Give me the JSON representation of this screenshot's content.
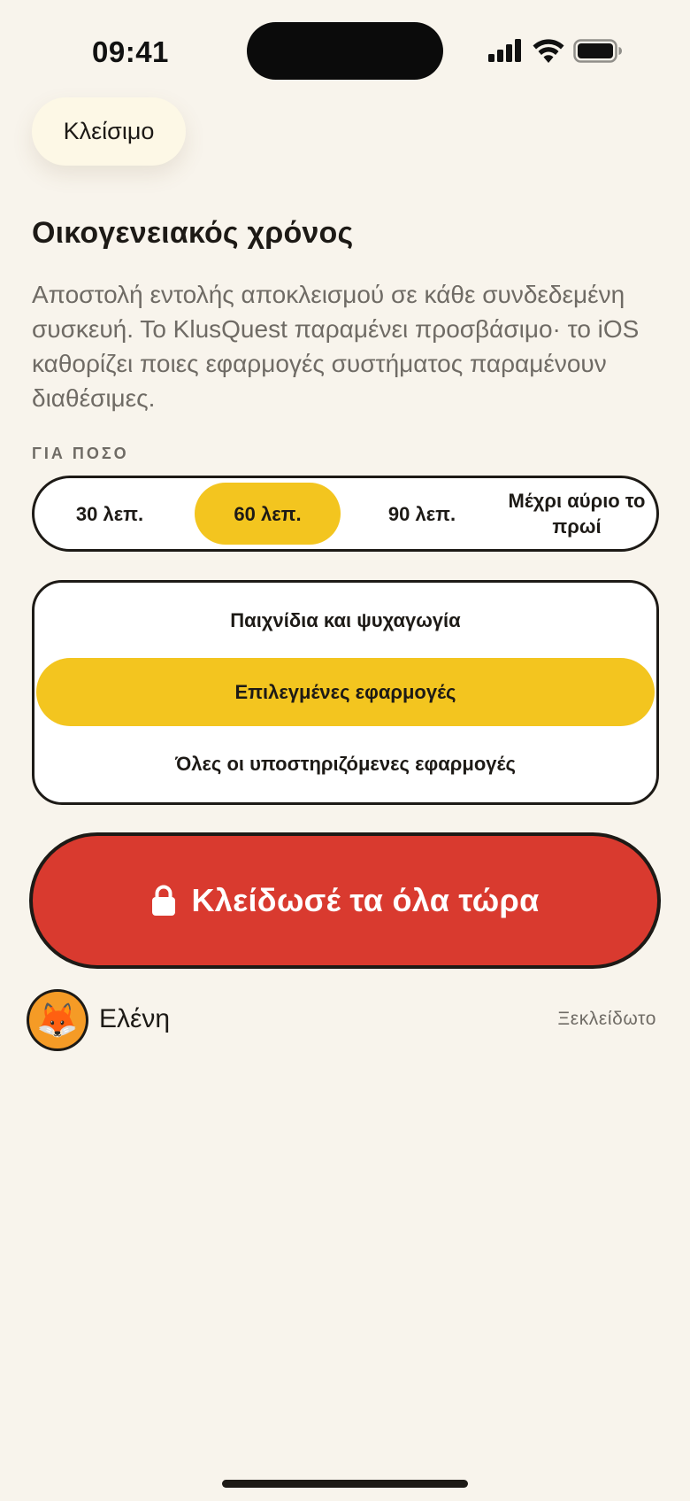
{
  "status_bar": {
    "time": "09:41",
    "icons": [
      "cellular-signal-icon",
      "wifi-icon",
      "battery-icon"
    ]
  },
  "header": {
    "close_label": "Κλείσιμο"
  },
  "main": {
    "title": "Οικογενειακός χρόνος",
    "description": "Αποστολή εντολής αποκλεισμού σε κάθε συνδεδεμένη συσκευή. Το KlusQuest παραμένει προσβάσιμο· το iOS καθορίζει ποιες εφαρμογές συστήματος παραμένουν διαθέσιμες.",
    "duration_label": "ΓΙΑ ΠΟΣΟ",
    "duration_options": [
      {
        "label": "30 λεπ.",
        "selected": false
      },
      {
        "label": "60 λεπ.",
        "selected": true
      },
      {
        "label": "90 λεπ.",
        "selected": false
      },
      {
        "label": "Μέχρι αύριο το πρωί",
        "selected": false
      }
    ],
    "scope_options": [
      {
        "label": "Παιχνίδια και ψυχαγωγία",
        "selected": false
      },
      {
        "label": "Επιλεγμένες εφαρμογές",
        "selected": true
      },
      {
        "label": "Όλες οι υποστηριζόμενες εφαρμογές",
        "selected": false
      }
    ],
    "lock_button_label": "Κλείδωσέ τα όλα τώρα",
    "child": {
      "avatar_emoji": "🦊",
      "name": "Ελένη",
      "status": "Ξεκλείδωτο"
    }
  },
  "colors": {
    "background": "#f8f4ec",
    "accent_yellow": "#f3c51f",
    "lock_red": "#d93a2f",
    "ink": "#1d1a16",
    "muted_text": "#6f6b65",
    "avatar_orange": "#f59b26"
  }
}
